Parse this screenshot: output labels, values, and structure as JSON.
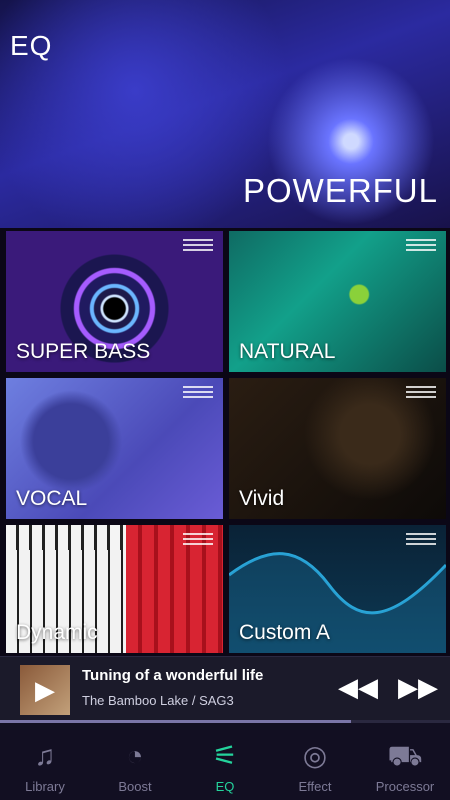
{
  "hero": {
    "title": "EQ",
    "preset_label": "POWERFUL"
  },
  "presets": [
    {
      "label": "SUPER BASS"
    },
    {
      "label": "NATURAL"
    },
    {
      "label": "VOCAL"
    },
    {
      "label": "Vivid"
    },
    {
      "label": "Dynamic"
    },
    {
      "label": "Custom A"
    }
  ],
  "now_playing": {
    "title": "Tuning of a wonderful life",
    "subtitle": "The Bamboo Lake / SAG3",
    "progress": 0.78
  },
  "tabs": [
    {
      "label": "Library",
      "icon": "library-icon"
    },
    {
      "label": "Boost",
      "icon": "speedometer-icon"
    },
    {
      "label": "EQ",
      "icon": "eq-wand-icon",
      "active": true
    },
    {
      "label": "Effect",
      "icon": "fx-icon"
    },
    {
      "label": "Processor",
      "icon": "car-icon"
    }
  ],
  "colors": {
    "accent": "#24d39c",
    "background": "#0b0716",
    "tab_inactive": "#7d7a96"
  }
}
